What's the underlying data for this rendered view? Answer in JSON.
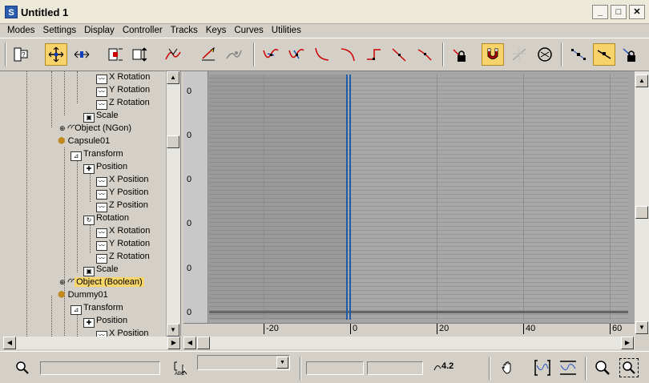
{
  "window": {
    "title": "Untitled 1",
    "app_icon": "S",
    "min": "_",
    "max": "□",
    "close": "✕"
  },
  "menu": [
    "Modes",
    "Settings",
    "Display",
    "Controller",
    "Tracks",
    "Keys",
    "Curves",
    "Utilities"
  ],
  "tree": [
    {
      "label": "X Rotation",
      "icon": "curve"
    },
    {
      "label": "Y Rotation",
      "icon": "curve"
    },
    {
      "label": "Z Rotation",
      "icon": "curve"
    },
    {
      "label": "Scale",
      "icon": "scale"
    },
    {
      "label": "Object (NGon)",
      "icon": "object"
    },
    {
      "label": "Capsule01",
      "icon": "cube"
    },
    {
      "label": "Transform",
      "icon": "transform"
    },
    {
      "label": "Position",
      "icon": "position"
    },
    {
      "label": "X Position",
      "icon": "curve"
    },
    {
      "label": "Y Position",
      "icon": "curve"
    },
    {
      "label": "Z Position",
      "icon": "curve"
    },
    {
      "label": "Rotation",
      "icon": "rotation"
    },
    {
      "label": "X Rotation",
      "icon": "curve"
    },
    {
      "label": "Y Rotation",
      "icon": "curve"
    },
    {
      "label": "Z Rotation",
      "icon": "curve"
    },
    {
      "label": "Scale",
      "icon": "scale"
    },
    {
      "label": "Object (Boolean)",
      "icon": "object",
      "selected": true
    },
    {
      "label": "Dummy01",
      "icon": "cube"
    },
    {
      "label": "Transform",
      "icon": "transform"
    },
    {
      "label": "Position",
      "icon": "position"
    },
    {
      "label": "X Position",
      "icon": "curve"
    }
  ],
  "curve_editor": {
    "y_labels": [
      "0",
      "0",
      "0",
      "0",
      "0",
      "0"
    ],
    "x_labels": [
      "-20",
      "0",
      "20",
      "40",
      "60"
    ]
  },
  "status": {
    "value_display": "4.2",
    "ddvalue": ""
  },
  "colors": {
    "selection": "#f9d668",
    "time_slider": "#1e5aa8",
    "active_tool": "#f8d26a"
  }
}
